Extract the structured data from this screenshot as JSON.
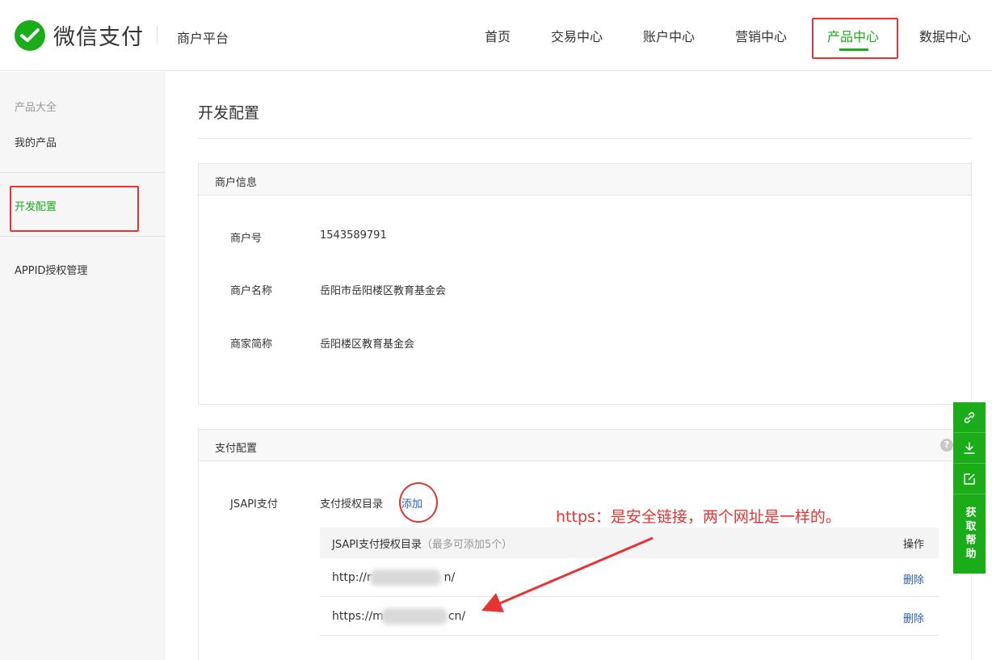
{
  "header": {
    "brand": "微信支付",
    "platform": "商户平台",
    "nav": [
      {
        "label": "首页"
      },
      {
        "label": "交易中心"
      },
      {
        "label": "账户中心"
      },
      {
        "label": "营销中心"
      },
      {
        "label": "产品中心"
      },
      {
        "label": "数据中心"
      }
    ],
    "active_nav": "产品中心"
  },
  "sidebar": {
    "title": "产品大全",
    "items": [
      {
        "label": "我的产品"
      },
      {
        "label": "开发配置"
      },
      {
        "label": "APPID授权管理"
      }
    ],
    "active_item": "开发配置"
  },
  "main": {
    "page_title": "开发配置",
    "merchant_info": {
      "heading": "商户信息",
      "fields": [
        {
          "label": "商户号",
          "value": "1543589791"
        },
        {
          "label": "商户名称",
          "value": "岳阳市岳阳楼区教育基金会"
        },
        {
          "label": "商家简称",
          "value": "岳阳楼区教育基金会"
        }
      ]
    },
    "pay_config": {
      "heading": "支付配置",
      "help_glyph": "?",
      "jsapi_label": "JSAPI支付",
      "dir_label": "支付授权目录",
      "add_label": "添加",
      "table": {
        "col_dir": "JSAPI支付授权目录",
        "col_dir_note": "（最多可添加5个）",
        "col_op": "操作",
        "rows": [
          {
            "url_prefix": "http://r",
            "url_suffix": "n/",
            "action": "删除"
          },
          {
            "url_prefix": "https://m",
            "url_suffix": "cn/",
            "action": "删除"
          }
        ]
      }
    },
    "annotation": "https：是安全链接，两个网址是一样的。"
  },
  "float_bar": {
    "icons": [
      "link-icon",
      "download-icon",
      "edit-icon"
    ],
    "help_label": "获取帮助"
  },
  "colors": {
    "brand_green": "#1aad19",
    "link_blue": "#2b5fb0",
    "annotation_red": "#e63333"
  }
}
